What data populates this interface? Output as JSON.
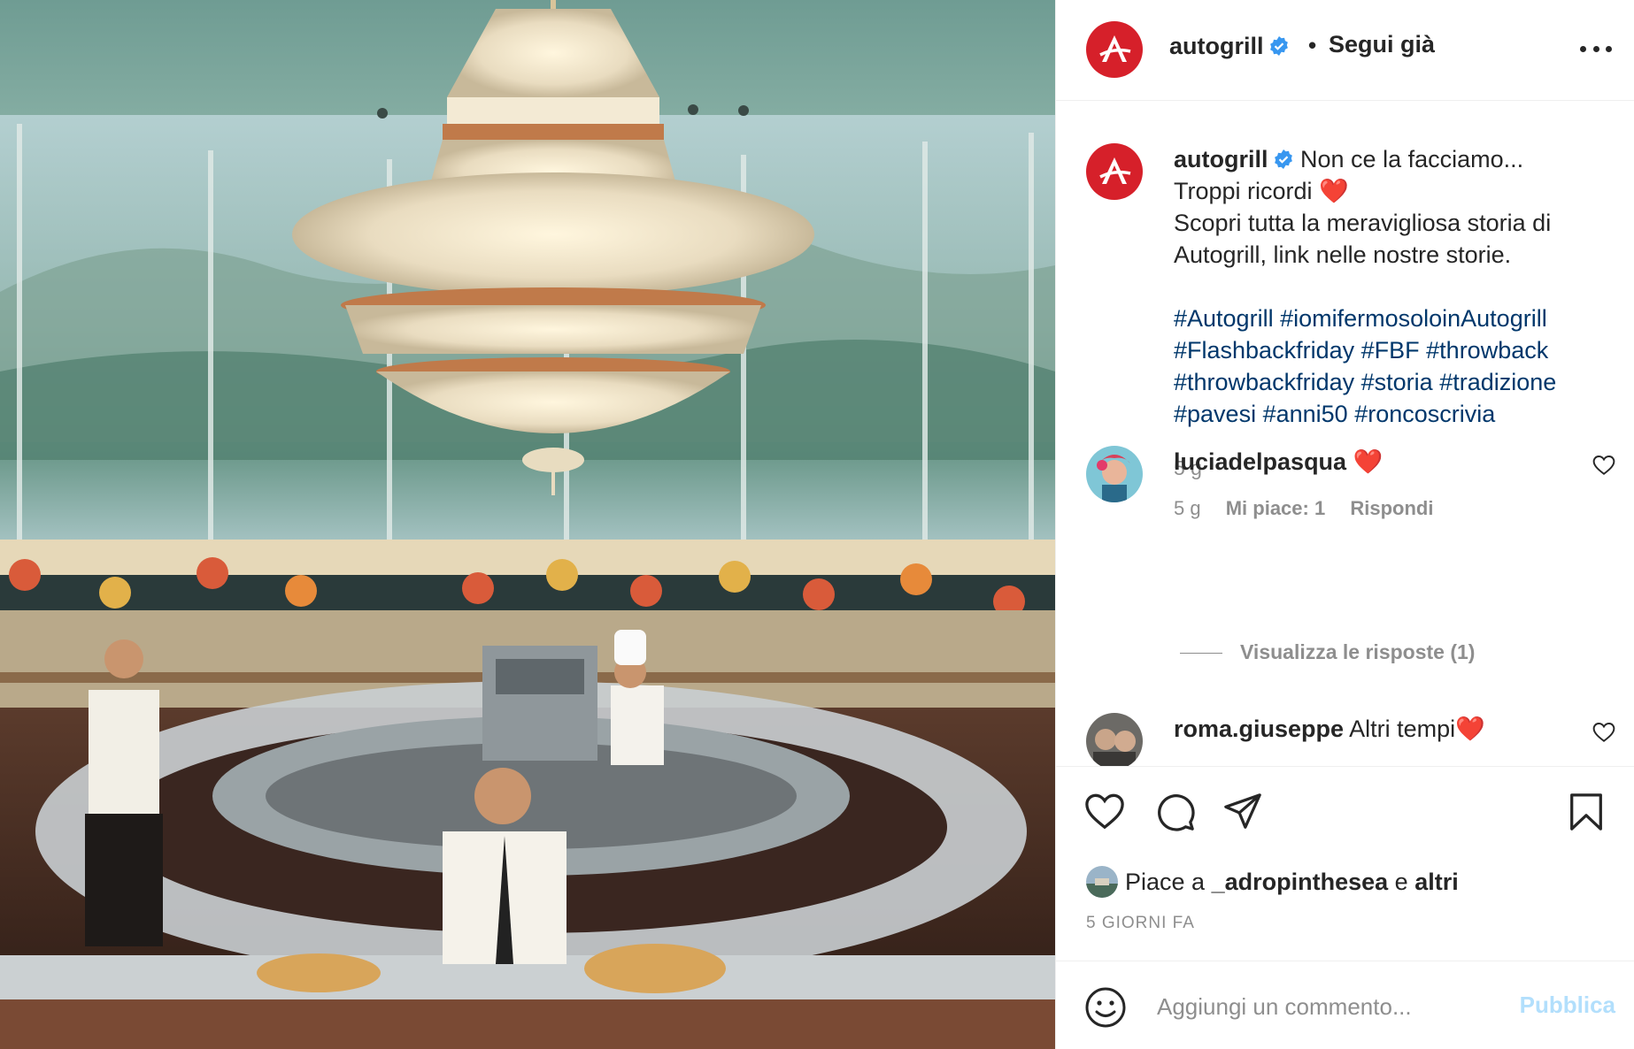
{
  "post": {
    "image_alt": "Vintage Autogrill restaurant interior with chandelier"
  },
  "header": {
    "username": "autogrill",
    "separator": "•",
    "follow_label": "Segui già"
  },
  "caption": {
    "username": "autogrill",
    "line1": "Non ce la facciamo...",
    "line2": "Troppi ricordi",
    "line2_emoji": "❤️",
    "line3": "Scopri tutta la meravigliosa storia di",
    "line4": "Autogrill, link nelle nostre storie.",
    "hashtags": [
      [
        "#Autogrill",
        "#iomifermosoloinAutogrill"
      ],
      [
        "#Flashbackfriday",
        "#FBF",
        "#throwback"
      ],
      [
        "#throwbackfriday",
        "#storia",
        "#tradizione"
      ],
      [
        "#pavesi",
        "#anni50",
        "#roncoscrivia"
      ]
    ],
    "time": "5 g"
  },
  "comments": [
    {
      "username": "luciadelpasqua",
      "text": "❤️",
      "time": "5 g",
      "likes": "Mi piace: 1",
      "reply": "Rispondi"
    },
    {
      "username": "roma.giuseppe",
      "text": "Altri tempi❤️"
    }
  ],
  "view_replies": "Visualizza le risposte (1)",
  "likes": {
    "prefix": "Piace a",
    "user": "_adropinthesea",
    "conj": "e",
    "others": "altri"
  },
  "date": "5 GIORNI FA",
  "comment_box": {
    "placeholder": "Aggiungi un commento...",
    "publish": "Pubblica"
  },
  "colors": {
    "brand_red": "#d6202a",
    "verified_blue": "#3897f0",
    "hashtag": "#00376b",
    "muted": "#8e8e8e",
    "publish_disabled": "#b2dffc"
  },
  "icons": [
    "autogrill-logo-icon",
    "verified-badge-icon",
    "more-options-icon",
    "heart-icon",
    "comment-icon",
    "share-icon",
    "bookmark-icon",
    "emoji-icon",
    "like-comment-icon"
  ]
}
